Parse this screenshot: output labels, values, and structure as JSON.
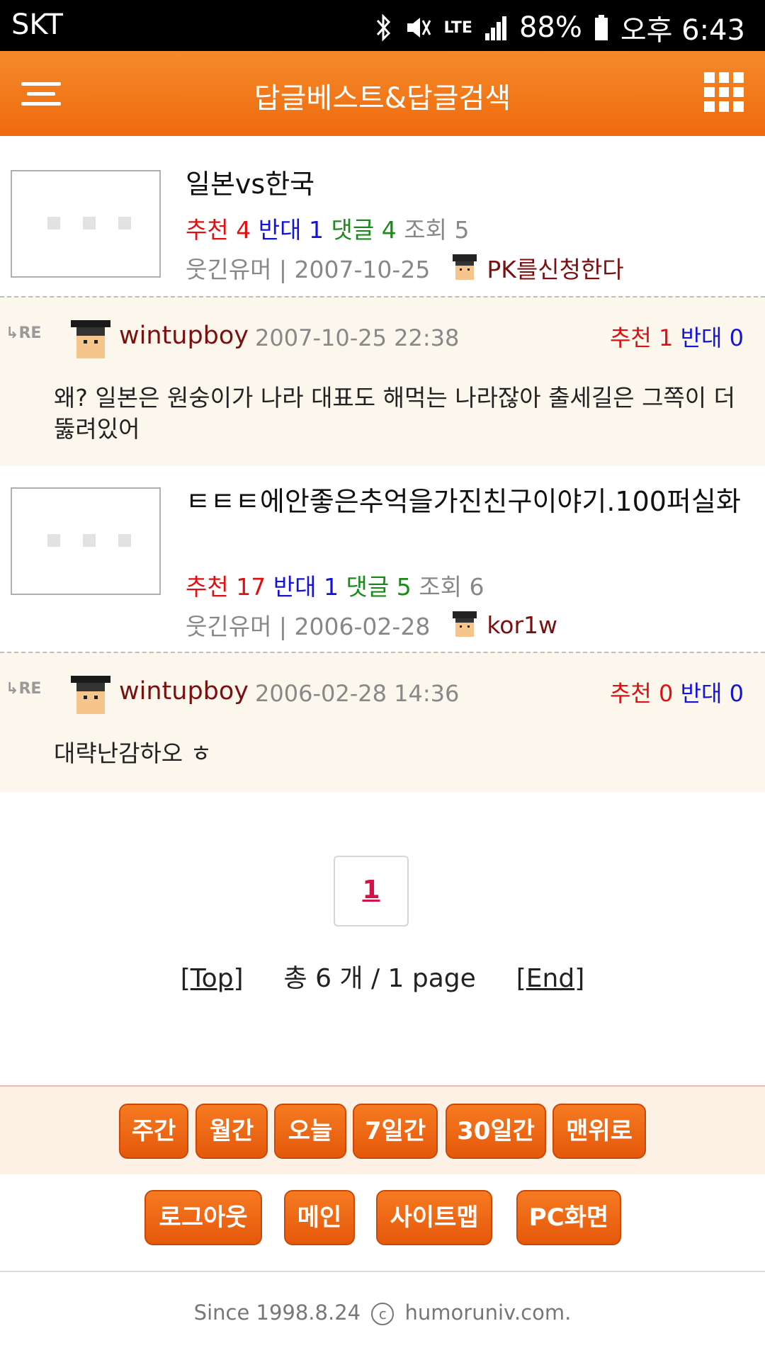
{
  "status_bar": {
    "carrier": "SKT",
    "network": "LTE",
    "battery": "88%",
    "time": "오후 6:43"
  },
  "header": {
    "title": "답글베스트&답글검색"
  },
  "posts": [
    {
      "title": "일본vs한국",
      "recommend_label": "추천",
      "recommend": "4",
      "oppose_label": "반대",
      "oppose": "1",
      "comments_label": "댓글",
      "comments": "4",
      "views_label": "조회",
      "views": "5",
      "meta": "웃긴유머 | 2007-10-25",
      "author": "PK를신청한다",
      "reply": {
        "re": "RE",
        "user": "wintupboy",
        "date": "2007-10-25 22:38",
        "recommend_label": "추천",
        "recommend": "1",
        "oppose_label": "반대",
        "oppose": "0",
        "text": "왜? 일본은 원숭이가 나라 대표도 해먹는 나라잖아 출세길은 그쪽이 더뚫려있어"
      }
    },
    {
      "title": "ㅌㅌㅌ에안좋은추억을가진친구이야기.100퍼실화",
      "recommend_label": "추천",
      "recommend": "17",
      "oppose_label": "반대",
      "oppose": "1",
      "comments_label": "댓글",
      "comments": "5",
      "views_label": "조회",
      "views": "6",
      "meta": "웃긴유머 | 2006-02-28",
      "author": "kor1w",
      "reply": {
        "re": "RE",
        "user": "wintupboy",
        "date": "2006-02-28 14:36",
        "recommend_label": "추천",
        "recommend": "0",
        "oppose_label": "반대",
        "oppose": "0",
        "text": "대략난감하오 ㅎ"
      }
    }
  ],
  "pagination": {
    "current_page": "1",
    "top_label": "Top",
    "end_label": "End",
    "summary": "총 6 개 / 1 page"
  },
  "bottom_nav_1": [
    "주간",
    "월간",
    "오늘",
    "7일간",
    "30일간",
    "맨위로"
  ],
  "bottom_nav_2": [
    "로그아웃",
    "메인",
    "사이트맵",
    "PC화면"
  ],
  "footer": {
    "since": "Since 1998.8.24",
    "copyright_symbol": "c",
    "domain": "humoruniv.com."
  },
  "colors": {
    "accent": "#ee6a0d",
    "recommend": "#e01010",
    "oppose": "#1414d8",
    "comments": "#1a8a1a",
    "author": "#7a1010"
  }
}
